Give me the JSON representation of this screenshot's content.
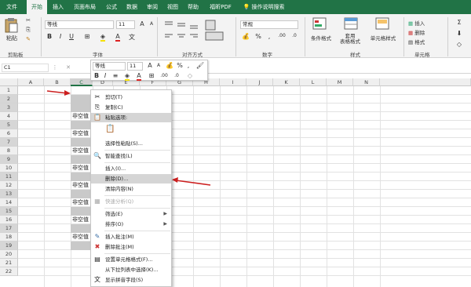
{
  "tabs": [
    "文件",
    "开始",
    "插入",
    "页面布局",
    "公式",
    "数据",
    "审阅",
    "视图",
    "帮助",
    "福昕PDF",
    "操作说明搜索"
  ],
  "ribbon": {
    "clipboard_label": "剪贴板",
    "paste": "粘贴",
    "font_label": "字体",
    "font_name": "等线",
    "font_size": "11",
    "bold": "B",
    "italic": "I",
    "underline": "U",
    "grow": "A",
    "shrink": "A",
    "font_color": "A",
    "wen": "文",
    "align_label": "对齐方式",
    "number_label": "数字",
    "number_format": "常规",
    "percent": "%",
    "comma": ",",
    "styles_label": "样式",
    "cond_fmt": "条件格式",
    "table_fmt": "套用\n表格格式",
    "cell_style": "单元格样式",
    "cells_label": "单元格",
    "insert": "插入",
    "delete": "删除",
    "format": "格式"
  },
  "formula": {
    "namebox": "C1",
    "fx": "fx"
  },
  "columns": [
    "A",
    "B",
    "C",
    "D",
    "E",
    "F",
    "G",
    "H",
    "I",
    "J",
    "K",
    "L",
    "M",
    "N"
  ],
  "rows": [
    "1",
    "2",
    "3",
    "4",
    "5",
    "6",
    "7",
    "8",
    "9",
    "10",
    "11",
    "12",
    "13",
    "14",
    "15",
    "16",
    "17",
    "18",
    "19",
    "20",
    "21",
    "22"
  ],
  "cell_text": "非空值",
  "mini_toolbar": {
    "font": "等线",
    "size": "11",
    "percent": "%",
    "comma": ","
  },
  "menu": [
    {
      "label": "剪切(T)",
      "icon": "✂"
    },
    {
      "label": "复制(C)",
      "icon": "⎘"
    },
    {
      "label": "粘贴选项:",
      "icon": "📋"
    },
    {
      "label": "",
      "icon": "📋"
    },
    {
      "label": "选择性粘贴(S)...",
      "icon": ""
    },
    {
      "label": "智能查找(L)",
      "icon": "🔍"
    },
    {
      "label": "插入(I)...",
      "icon": ""
    },
    {
      "label": "删除(D)...",
      "icon": ""
    },
    {
      "label": "清除内容(N)",
      "icon": ""
    },
    {
      "label": "快速分析(Q)",
      "icon": "▦"
    },
    {
      "label": "筛选(E)",
      "icon": ""
    },
    {
      "label": "排序(O)",
      "icon": ""
    },
    {
      "label": "插入批注(M)",
      "icon": "✎"
    },
    {
      "label": "删除批注(M)",
      "icon": "✖"
    },
    {
      "label": "设置单元格格式(F)...",
      "icon": "▤"
    },
    {
      "label": "从下拉列表中选择(K)...",
      "icon": ""
    },
    {
      "label": "显示拼音字段(S)",
      "icon": "文"
    }
  ],
  "colors": {
    "brand": "#217346",
    "arrow": "#cc1f1f"
  }
}
